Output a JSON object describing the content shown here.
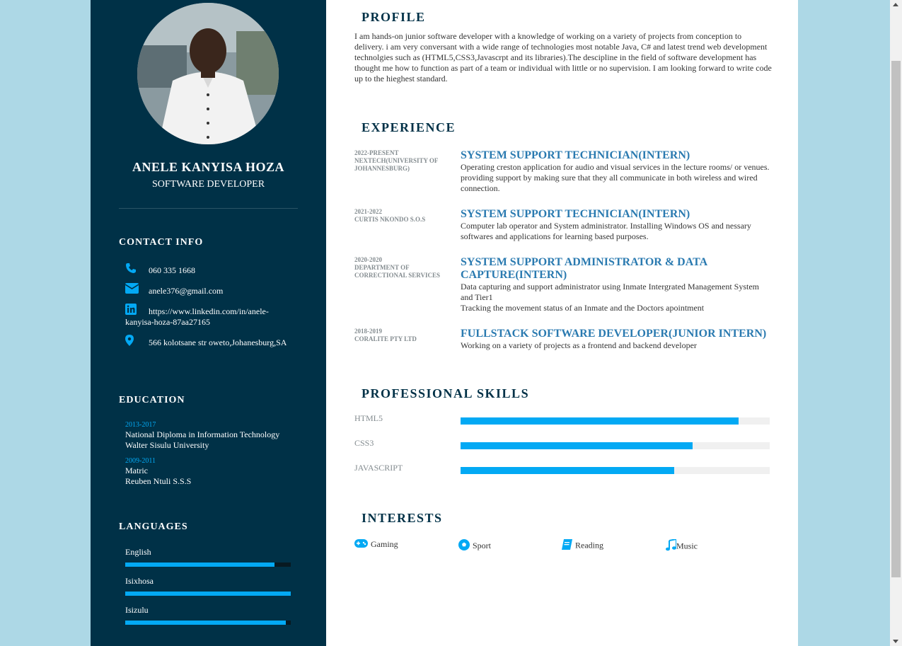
{
  "sidebar": {
    "name": "ANELE KANYISA HOZA",
    "role": "SOFTWARE DEVELOPER",
    "contact_title": "CONTACT INFO",
    "contact": {
      "phone": "060 335 1668",
      "email": "anele376@gmail.com",
      "linkedin": "https://www.linkedin.com/in/anele-kanyisa-hoza-87aa27165",
      "address": "566 kolotsane str oweto,Johanesburg,SA"
    },
    "education_title": "EDUCATION",
    "education": [
      {
        "years": "2013-2017",
        "degree": "National Diploma in Information Technology",
        "school": "Walter Sisulu University"
      },
      {
        "years": "2009-2011",
        "degree": "Matric",
        "school": "Reuben Ntuli S.S.S"
      }
    ],
    "languages_title": "LANGUAGES",
    "languages": [
      {
        "name": "English",
        "level": 0.9
      },
      {
        "name": "Isixhosa",
        "level": 1.0
      },
      {
        "name": "Isizulu",
        "level": 0.97
      }
    ]
  },
  "main": {
    "profile_title": "PROFILE",
    "profile_text": "I am hands-on junior software developer with a knowledge of working on a variety of projects from conception to delivery. i am very conversant with a wide range of technologies most notable Java, C# and latest trend web development technolgies such as (HTML5,CSS3,Javascrpt and its libraries).The descipline in the field of software development has thought me how to function as part of a team or individual with little or no supervision. I am looking forward to write code up to the hieghest standard.",
    "experience_title": "EXPERIENCE",
    "experience": [
      {
        "years": "2022-PRESENT",
        "company": "NEXTECH(UNIVERSITY OF JOHANNESBURG)",
        "title": "SYSTEM SUPPORT TECHNICIAN(INTERN)",
        "desc": "Operating creston application for audio and visual services in the lecture rooms/ or venues. providing support by making sure that they all communicate in both wireless and wired connection."
      },
      {
        "years": "2021-2022",
        "company": "CURTIS NKONDO S.O.S",
        "title": "SYSTEM SUPPORT TECHNICIAN(INTERN)",
        "desc": "Computer lab operator and System administrator. Installing Windows OS and nessary softwares and applications for learning based purposes."
      },
      {
        "years": "2020-2020",
        "company": "DEPARTMENT OF CORRECTIONAL SERVICES",
        "title": "SYSTEM SUPPORT ADMINISTRATOR & DATA CAPTURE(INTERN)",
        "desc": "Data capturing and support administrator using Inmate Intergrated Management System and Tier1",
        "desc2": "Tracking the movement status of an Inmate and the Doctors apointment"
      },
      {
        "years": "2018-2019",
        "company": "CORALITE PTY LTD",
        "title": "FULLSTACK SOFTWARE DEVELOPER(JUNIOR INTERN)",
        "desc": "Working on a variety of projects as a frontend and backend developer"
      }
    ],
    "skills_title": "PROFESSIONAL SKILLS",
    "skills": [
      {
        "name": "HTML5",
        "level": 0.9
      },
      {
        "name": "CSS3",
        "level": 0.75
      },
      {
        "name": "JAVASCRIPT",
        "level": 0.69
      }
    ],
    "interests_title": "INTERESTS",
    "interests": [
      "Gaming",
      "Sport",
      "Reading",
      "Music"
    ]
  },
  "colors": {
    "sidebar_bg": "#003147",
    "accent": "#03a9f4",
    "job_title": "#2a7ab0",
    "page_bg": "#add8e6"
  }
}
